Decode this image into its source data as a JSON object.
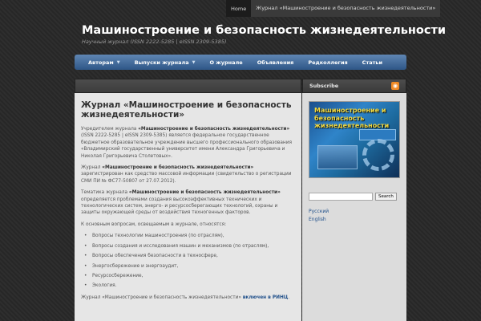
{
  "topbar": {
    "items": [
      "Home",
      "Журнал «Машиностроение и безопасность жизнедеятельности»"
    ]
  },
  "site": {
    "title": "Машиностроение и безопасность жизнедеятельности",
    "description": "Научный журнал (ISSN 2222-5285 | eISSN 2309-5385)"
  },
  "nav": {
    "items": [
      "Авторам",
      "Выпуски журнала",
      "О журнале",
      "Объявления",
      "Редколлегия",
      "Статьи"
    ]
  },
  "content": {
    "title": "Журнал «Машиностроение и безопасность жизнедеятельности»",
    "p1_pre": "Учредителем журнала ",
    "journal_name": "«Машиностроение и безопасность жизнедеятельности»",
    "p1_post": " (ISSN 2222-5285 | eISSN 2309-5385) является федеральное государственное бюджетное образовательное учреждение высшего профессионального образования «Владимирский государственный университет имени Александра Григорьевича и Николая Григорьевича Столетовых».",
    "p2_pre": "Журнал ",
    "p2_post": " зарегистрирован как средство массовой информации (свидетельство о регистрации СМИ ПИ № ФС77-50807 от 27.07.2012).",
    "p3_pre": "Тематика журнала ",
    "p3_post": " определяется проблемами создания высокоэффективных технических и технологических систем, энерго- и ресурсосберегающих технологий, охраны и защиты окружающей среды от воздействия техногенных факторов.",
    "p4": "К основным вопросам, освещаемым в журнале, относятся:",
    "list": [
      "Вопросы технологии машиностроения (по отраслям),",
      "Вопросы создания и исследования машин и механизмов (по отраслям),",
      "Вопросы обеспечения безопасности в техносфере,",
      "Энергосбережение и энергоаудит,",
      "Ресурсосбережение,",
      "Экология."
    ],
    "p5_pre": "Журнал «Машиностроение и безопасность жизнедеятельности» ",
    "p5_link": "включен в РИНЦ",
    "p5_post": "."
  },
  "sidebar": {
    "title": "Subscribe",
    "rss_icon": "rss-icon",
    "banner_text": "Машиностроение и безопасность жизнедеятельности",
    "search_button": "Search",
    "languages": [
      "Русский",
      "English"
    ]
  }
}
